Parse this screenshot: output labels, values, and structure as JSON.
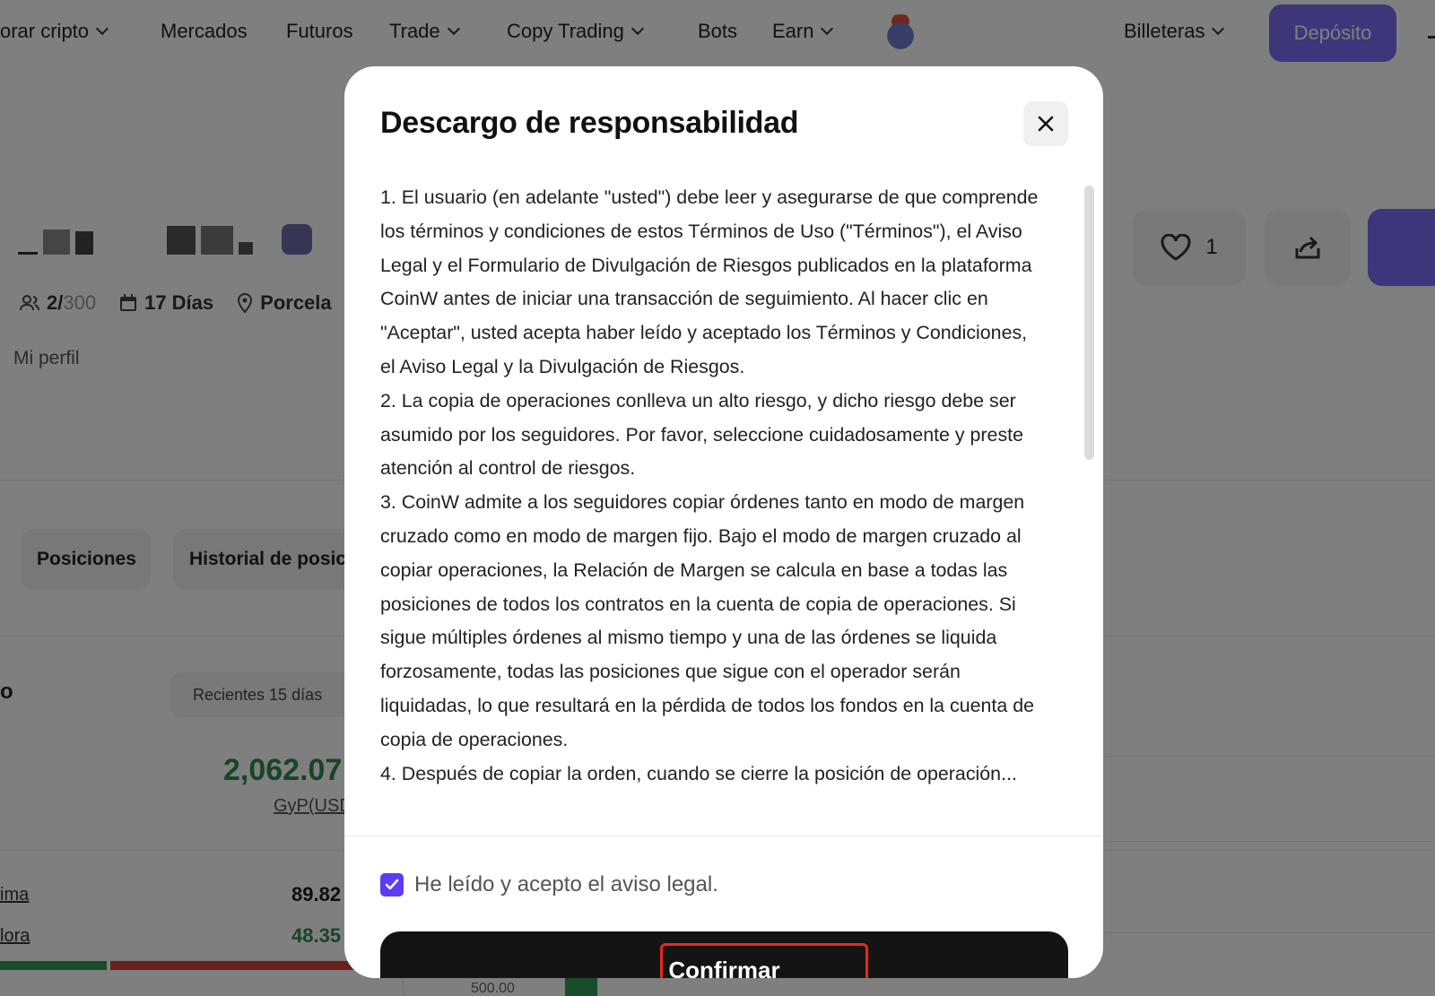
{
  "nav": {
    "items": [
      {
        "label": "orar cripto",
        "dropdown": true
      },
      {
        "label": "Mercados",
        "dropdown": false
      },
      {
        "label": "Futuros",
        "dropdown": false
      },
      {
        "label": "Trade",
        "dropdown": true
      },
      {
        "label": "Copy Trading",
        "dropdown": true
      },
      {
        "label": "Bots",
        "dropdown": false
      },
      {
        "label": "Earn",
        "dropdown": true
      }
    ],
    "wallets": "Billeteras",
    "deposit": "Depósito"
  },
  "profile": {
    "followers_current": "2/",
    "followers_max": "300",
    "days": "17 Días",
    "location": "Porcela",
    "my_profile": "Mi perfil",
    "likes": "1"
  },
  "tabs": [
    "Posiciones",
    "Historial de posic"
  ],
  "stats": {
    "section_fragment": "o",
    "period": "Recientes 15 días",
    "pnl": "2,062.07",
    "pnl_label": "GyP(USD",
    "row1_label": "ima",
    "row1_value": "89.82",
    "row2_label": "lora",
    "row2_value": "48.35",
    "chart_tick": "500.00"
  },
  "modal": {
    "title": "Descargo de responsabilidad",
    "paragraphs": [
      "1. El usuario (en adelante \"usted\") debe leer y asegurarse de que comprende los términos y condiciones de estos Términos de Uso (\"Términos\"), el Aviso Legal y el Formulario de Divulgación de Riesgos publicados en la plataforma CoinW antes de iniciar una transacción de seguimiento. Al hacer clic en \"Aceptar\", usted acepta haber leído y aceptado los Términos y Condiciones, el Aviso Legal y la Divulgación de Riesgos.",
      "2. La copia de operaciones conlleva un alto riesgo, y dicho riesgo debe ser asumido por los seguidores. Por favor, seleccione cuidadosamente y preste atención al control de riesgos.",
      "3. CoinW admite a los seguidores copiar órdenes tanto en modo de margen cruzado como en modo de margen fijo. Bajo el modo de margen cruzado al copiar operaciones, la Relación de Margen se calcula en base a todas las posiciones de todos los contratos en la cuenta de copia de operaciones. Si sigue múltiples órdenes al mismo tiempo y una de las órdenes se liquida forzosamente, todas las posiciones que sigue con el operador serán liquidadas, lo que resultará en la pérdida de todos los fondos en la cuenta de copia de operaciones.",
      "4. Después de copiar la orden, cuando se cierre la posición de operación..."
    ],
    "checkbox_label": "He leído y acepto el aviso legal.",
    "checkbox_checked": true,
    "confirm": "Confirmar"
  },
  "colors": {
    "accent": "#7b6cf6",
    "checkbox": "#5b3df5",
    "highlight": "#e8281c",
    "positive": "#2e8b4e",
    "negative": "#d0433a"
  },
  "progress": {
    "win_fraction": 0.3
  }
}
